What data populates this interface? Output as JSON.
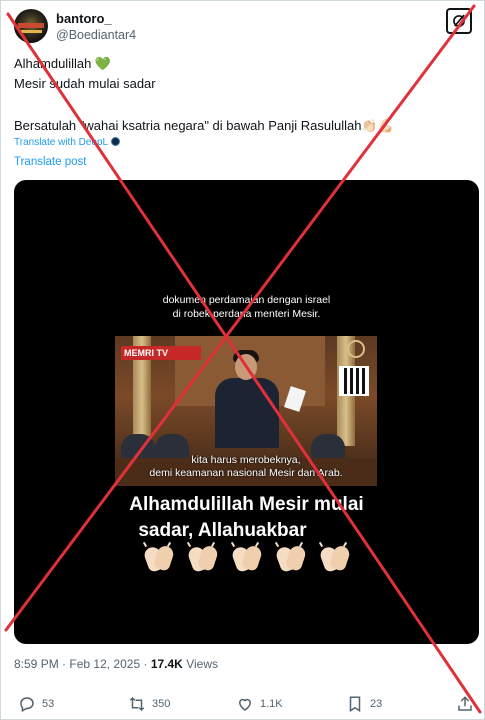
{
  "author": {
    "name": "bantoro_",
    "handle": "@Boediantar4"
  },
  "tweet": {
    "line1": "Alhamdulillah 💚",
    "line2": "Mesir sudah mulai sadar",
    "line3": "Bersatulah \"wahai ksatria negara\" di bawah Panji Rasulullah👏🏻💪🏻",
    "translate_deepl": "Translate with DeepL",
    "translate_post": "Translate post"
  },
  "media": {
    "caption_top_1": "dokumen perdamaian dengan israel",
    "caption_top_2": "di robek perdana menteri Mesir.",
    "watermark": "MEMRI TV",
    "video_caption_1": "kita harus merobeknya,",
    "video_caption_2": "demi keamanan nasional Mesir dan Arab.",
    "big_text_1": "Alhamdulillah Mesir mulai",
    "big_text_2": "sadar, Allahuakbar",
    "clap_count": 5
  },
  "meta": {
    "time": "8:59 PM",
    "date": "Feb 12, 2025",
    "views_count": "17.4K",
    "views_label": "Views"
  },
  "actions": {
    "replies": "53",
    "reposts": "350",
    "likes": "1.1K",
    "bookmarks": "23"
  },
  "colors": {
    "accent": "#1d9bf0",
    "x_overlay": "#e0303a",
    "secondary_text": "#536471"
  },
  "icons": [
    "grok-icon",
    "reply-icon",
    "repost-icon",
    "like-icon",
    "bookmark-icon",
    "share-icon",
    "deepl-icon",
    "green-heart-emoji",
    "clap-emoji"
  ]
}
